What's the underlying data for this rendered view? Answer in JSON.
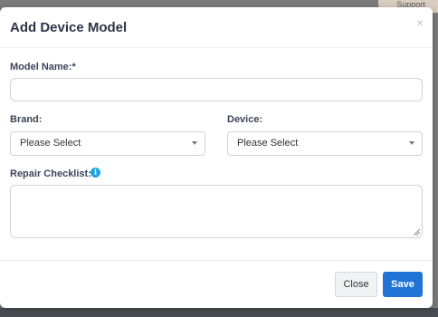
{
  "modal": {
    "title": "Add Device Model",
    "close_glyph": "×"
  },
  "form": {
    "model_name_label": "Model Name:*",
    "model_name_value": "",
    "brand_label": "Brand:",
    "brand_value": "Please Select",
    "device_label": "Device:",
    "device_value": "Please Select",
    "repair_checklist_label": "Repair Checklist:",
    "repair_checklist_info": "i",
    "repair_checklist_value": ""
  },
  "footer": {
    "close_label": "Close",
    "save_label": "Save"
  },
  "background": {
    "corner_text": "Support"
  },
  "colors": {
    "primary": "#1f74d6",
    "info": "#1aa5e0",
    "backdrop": "#7b7b7b"
  },
  "icons": {
    "modal_close": "close-icon",
    "select_caret": "chevron-down-icon",
    "info": "info-icon",
    "resize": "resize-grip-icon"
  }
}
